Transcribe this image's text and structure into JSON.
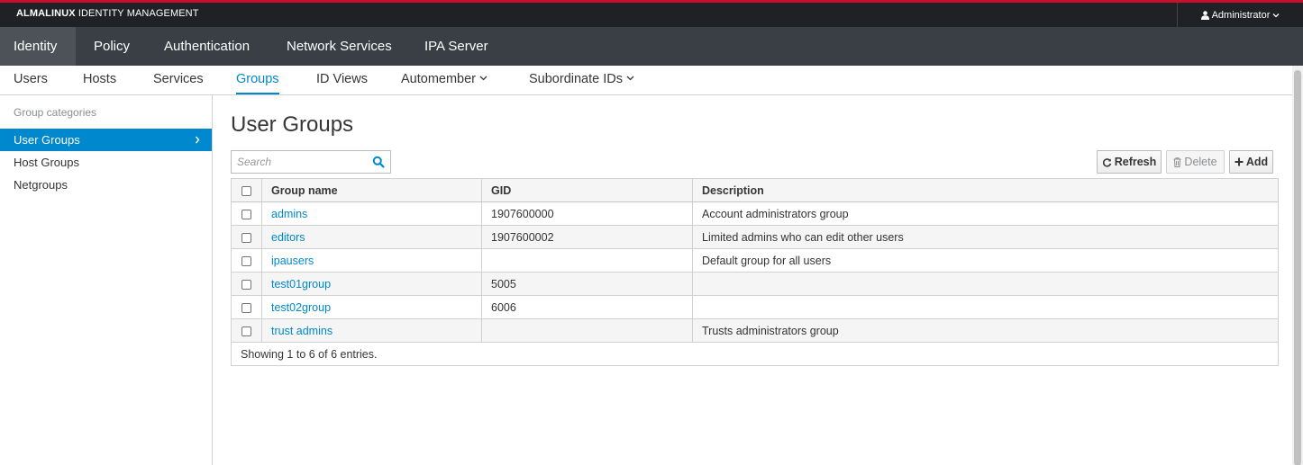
{
  "topbar": {
    "brand_bold": "ALMALINUX",
    "brand_rest": " IDENTITY MANAGEMENT",
    "user_label": "Administrator",
    "accent_color": "#c8102e"
  },
  "primary_nav": [
    "Identity",
    "Policy",
    "Authentication",
    "Network Services",
    "IPA Server"
  ],
  "secondary_nav": [
    "Users",
    "Hosts",
    "Services",
    "Groups",
    "ID Views",
    "Automember",
    "Subordinate IDs"
  ],
  "sidebar": {
    "heading": "Group categories",
    "items": [
      "User Groups",
      "Host Groups",
      "Netgroups"
    ]
  },
  "main": {
    "title": "User Groups",
    "search_placeholder": "Search",
    "buttons": {
      "refresh": "Refresh",
      "delete": "Delete",
      "add": "Add"
    },
    "table": {
      "headers": [
        "Group name",
        "GID",
        "Description"
      ],
      "rows": [
        {
          "name": "admins",
          "gid": "1907600000",
          "description": "Account administrators group"
        },
        {
          "name": "editors",
          "gid": "1907600002",
          "description": "Limited admins who can edit other users"
        },
        {
          "name": "ipausers",
          "gid": "",
          "description": "Default group for all users"
        },
        {
          "name": "test01group",
          "gid": "5005",
          "description": ""
        },
        {
          "name": "test02group",
          "gid": "6006",
          "description": ""
        },
        {
          "name": "trust admins",
          "gid": "",
          "description": "Trusts administrators group"
        }
      ],
      "footer": "Showing 1 to 6 of 6 entries."
    }
  },
  "colors": {
    "link": "#0088ce",
    "active_sidebar": "#0088ce",
    "nav_bg": "#393f44",
    "topbar_bg": "#1f2124"
  }
}
